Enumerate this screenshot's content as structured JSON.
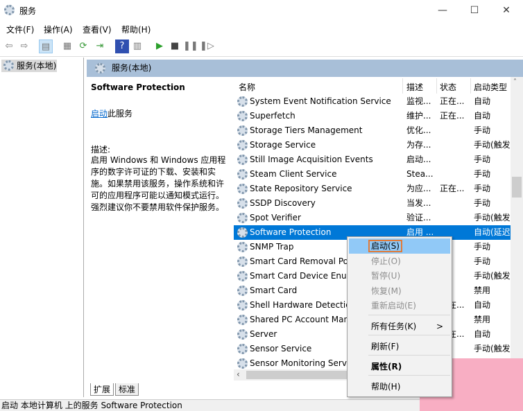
{
  "window": {
    "title": "服务",
    "minimize": "—",
    "maximize": "☐",
    "close": "✕"
  },
  "menubar": [
    "文件(F)",
    "操作(A)",
    "查看(V)",
    "帮助(H)"
  ],
  "toolbar": [
    "back",
    "forward",
    "show-hide-tree",
    "properties",
    "refresh",
    "export",
    "help",
    "show-action-pane",
    "start",
    "stop",
    "pause",
    "resume"
  ],
  "tree": {
    "item": "服务(本地)"
  },
  "panel": {
    "title": "服务(本地)"
  },
  "description": {
    "service_name": "Software Protection",
    "start_link": "启动",
    "start_suffix": "此服务",
    "desc_label": "描述:",
    "desc_text": "启用 Windows 和 Windows 应用程序的数字许可证的下载、安装和实施。如果禁用该服务，操作系统和许可的应用程序可能以通知模式运行。强烈建议你不要禁用软件保护服务。"
  },
  "columns": [
    "名称",
    "描述",
    "状态",
    "启动类型"
  ],
  "rows": [
    {
      "name": "System Event Notification Service",
      "desc": "监视...",
      "status": "正在...",
      "startup": "自动"
    },
    {
      "name": "Superfetch",
      "desc": "维护...",
      "status": "正在...",
      "startup": "自动"
    },
    {
      "name": "Storage Tiers Management",
      "desc": "优化...",
      "status": "",
      "startup": "手动"
    },
    {
      "name": "Storage Service",
      "desc": "为存...",
      "status": "",
      "startup": "手动(触发"
    },
    {
      "name": "Still Image Acquisition Events",
      "desc": "启动...",
      "status": "",
      "startup": "手动"
    },
    {
      "name": "Steam Client Service",
      "desc": "Stea...",
      "status": "",
      "startup": "手动"
    },
    {
      "name": "State Repository Service",
      "desc": "为应...",
      "status": "正在...",
      "startup": "手动"
    },
    {
      "name": "SSDP Discovery",
      "desc": "当发...",
      "status": "",
      "startup": "手动"
    },
    {
      "name": "Spot Verifier",
      "desc": "验证...",
      "status": "",
      "startup": "手动(触发"
    },
    {
      "name": "Software Protection",
      "desc": "启用 ...",
      "status": "",
      "startup": "自动(延迟"
    },
    {
      "name": "SNMP Trap",
      "desc": "",
      "status": "",
      "startup": "手动"
    },
    {
      "name": "Smart Card Removal Po",
      "desc": "",
      "status": "",
      "startup": "手动"
    },
    {
      "name": "Smart Card Device Enun",
      "desc": "",
      "status": "",
      "startup": "手动(触发"
    },
    {
      "name": "Smart Card",
      "desc": "",
      "status": "",
      "startup": "禁用"
    },
    {
      "name": "Shell Hardware Detectio",
      "desc": "",
      "status": "正在...",
      "startup": "自动"
    },
    {
      "name": "Shared PC Account Man",
      "desc": "",
      "status": "",
      "startup": "禁用"
    },
    {
      "name": "Server",
      "desc": "",
      "status": "正在...",
      "startup": "自动"
    },
    {
      "name": "Sensor Service",
      "desc": "",
      "status": "",
      "startup": "手动(触发"
    },
    {
      "name": "Sensor Monitoring Serv",
      "desc": "",
      "status": "",
      "startup": "手动(触发"
    }
  ],
  "selected_row": "Software Protection",
  "tabs": [
    "扩展",
    "标准"
  ],
  "context_menu": [
    {
      "label": "启动(S)",
      "enabled": true,
      "highlighted": true
    },
    {
      "label": "停止(O)",
      "enabled": false
    },
    {
      "label": "暂停(U)",
      "enabled": false
    },
    {
      "label": "恢复(M)",
      "enabled": false
    },
    {
      "label": "重新启动(E)",
      "enabled": false
    },
    {
      "label": "所有任务(K)",
      "enabled": true,
      "submenu": ">"
    },
    {
      "label": "刷新(F)",
      "enabled": true
    },
    {
      "label": "属性(R)",
      "enabled": true,
      "bold": true
    },
    {
      "label": "帮助(H)",
      "enabled": true
    }
  ],
  "statusbar": "启动 本地计算机 上的服务 Software Protection",
  "colors": {
    "selection": "#0078d7",
    "panel_header": "#a8bfd8",
    "menu_highlight": "#91c9f7",
    "highlight_border": "#e07b39"
  }
}
